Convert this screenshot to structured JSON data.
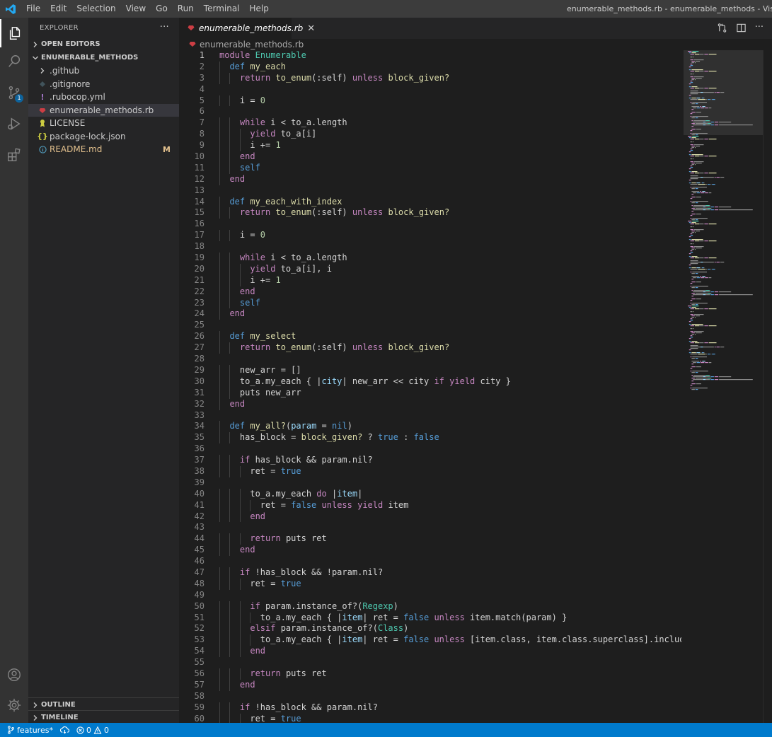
{
  "menu": [
    "File",
    "Edit",
    "Selection",
    "View",
    "Go",
    "Run",
    "Terminal",
    "Help"
  ],
  "window_title": "enumerable_methods.rb - enumerable_methods - Visual Studio Code",
  "sidebar": {
    "title": "EXPLORER",
    "more": "···",
    "open_editors": "OPEN EDITORS",
    "workspace": "ENUMERABLE_METHODS",
    "items": [
      {
        "label": ".github",
        "icon": "chevron-right-icon",
        "git": ""
      },
      {
        "label": ".gitignore",
        "icon": "gitignore-file-icon",
        "git": ""
      },
      {
        "label": ".rubocop.yml",
        "icon": "yaml-file-icon",
        "git": ""
      },
      {
        "label": "enumerable_methods.rb",
        "icon": "ruby-file-icon",
        "git": ""
      },
      {
        "label": "LICENSE",
        "icon": "license-file-icon",
        "git": ""
      },
      {
        "label": "package-lock.json",
        "icon": "json-file-icon",
        "git": ""
      },
      {
        "label": "README.md",
        "icon": "info-file-icon",
        "git": "M"
      }
    ],
    "outline": "OUTLINE",
    "timeline": "TIMELINE"
  },
  "editor": {
    "tab_label": "enumerable_methods.rb",
    "breadcrumb": "enumerable_methods.rb",
    "lines": [
      [
        [
          "kw",
          "module"
        ],
        [
          "t",
          " "
        ],
        [
          "cls",
          "Enumerable"
        ]
      ],
      [
        [
          "t",
          "  "
        ],
        [
          "def",
          "def"
        ],
        [
          "t",
          " "
        ],
        [
          "fn",
          "my_each"
        ]
      ],
      [
        [
          "t",
          "    "
        ],
        [
          "kw",
          "return"
        ],
        [
          "t",
          " "
        ],
        [
          "fn",
          "to_enum"
        ],
        [
          "t",
          "(:self) "
        ],
        [
          "kw",
          "unless"
        ],
        [
          "t",
          " "
        ],
        [
          "fn",
          "block_given?"
        ]
      ],
      [],
      [
        [
          "t",
          "    i = "
        ],
        [
          "num",
          "0"
        ]
      ],
      [],
      [
        [
          "t",
          "    "
        ],
        [
          "kw",
          "while"
        ],
        [
          "t",
          " i < to_a.length"
        ]
      ],
      [
        [
          "t",
          "      "
        ],
        [
          "kw",
          "yield"
        ],
        [
          "t",
          " to_a[i]"
        ]
      ],
      [
        [
          "t",
          "      i += "
        ],
        [
          "num",
          "1"
        ]
      ],
      [
        [
          "t",
          "    "
        ],
        [
          "kw",
          "end"
        ]
      ],
      [
        [
          "t",
          "    "
        ],
        [
          "con",
          "self"
        ]
      ],
      [
        [
          "t",
          "  "
        ],
        [
          "kw",
          "end"
        ]
      ],
      [],
      [
        [
          "t",
          "  "
        ],
        [
          "def",
          "def"
        ],
        [
          "t",
          " "
        ],
        [
          "fn",
          "my_each_with_index"
        ]
      ],
      [
        [
          "t",
          "    "
        ],
        [
          "kw",
          "return"
        ],
        [
          "t",
          " "
        ],
        [
          "fn",
          "to_enum"
        ],
        [
          "t",
          "(:self) "
        ],
        [
          "kw",
          "unless"
        ],
        [
          "t",
          " "
        ],
        [
          "fn",
          "block_given?"
        ]
      ],
      [],
      [
        [
          "t",
          "    i = "
        ],
        [
          "num",
          "0"
        ]
      ],
      [],
      [
        [
          "t",
          "    "
        ],
        [
          "kw",
          "while"
        ],
        [
          "t",
          " i < to_a.length"
        ]
      ],
      [
        [
          "t",
          "      "
        ],
        [
          "kw",
          "yield"
        ],
        [
          "t",
          " to_a[i], i"
        ]
      ],
      [
        [
          "t",
          "      i += "
        ],
        [
          "num",
          "1"
        ]
      ],
      [
        [
          "t",
          "    "
        ],
        [
          "kw",
          "end"
        ]
      ],
      [
        [
          "t",
          "    "
        ],
        [
          "con",
          "self"
        ]
      ],
      [
        [
          "t",
          "  "
        ],
        [
          "kw",
          "end"
        ]
      ],
      [],
      [
        [
          "t",
          "  "
        ],
        [
          "def",
          "def"
        ],
        [
          "t",
          " "
        ],
        [
          "fn",
          "my_select"
        ]
      ],
      [
        [
          "t",
          "    "
        ],
        [
          "kw",
          "return"
        ],
        [
          "t",
          " "
        ],
        [
          "fn",
          "to_enum"
        ],
        [
          "t",
          "(:self) "
        ],
        [
          "kw",
          "unless"
        ],
        [
          "t",
          " "
        ],
        [
          "fn",
          "block_given?"
        ]
      ],
      [],
      [
        [
          "t",
          "    new_arr = []"
        ]
      ],
      [
        [
          "t",
          "    to_a.my_each { |"
        ],
        [
          "var",
          "city"
        ],
        [
          "t",
          "| new_arr << city "
        ],
        [
          "kw",
          "if"
        ],
        [
          "t",
          " "
        ],
        [
          "kw",
          "yield"
        ],
        [
          "t",
          " city }"
        ]
      ],
      [
        [
          "t",
          "    puts new_arr"
        ]
      ],
      [
        [
          "t",
          "  "
        ],
        [
          "kw",
          "end"
        ]
      ],
      [],
      [
        [
          "t",
          "  "
        ],
        [
          "def",
          "def"
        ],
        [
          "t",
          " "
        ],
        [
          "fn",
          "my_all?"
        ],
        [
          "t",
          "("
        ],
        [
          "var",
          "param"
        ],
        [
          "t",
          " = "
        ],
        [
          "con",
          "nil"
        ],
        [
          "t",
          ")"
        ]
      ],
      [
        [
          "t",
          "    has_block = "
        ],
        [
          "fn",
          "block_given?"
        ],
        [
          "t",
          " ? "
        ],
        [
          "con",
          "true"
        ],
        [
          "t",
          " : "
        ],
        [
          "con",
          "false"
        ]
      ],
      [],
      [
        [
          "t",
          "    "
        ],
        [
          "kw",
          "if"
        ],
        [
          "t",
          " has_block && param.nil?"
        ]
      ],
      [
        [
          "t",
          "      ret = "
        ],
        [
          "con",
          "true"
        ]
      ],
      [],
      [
        [
          "t",
          "      to_a.my_each "
        ],
        [
          "kw",
          "do"
        ],
        [
          "t",
          " |"
        ],
        [
          "var",
          "item"
        ],
        [
          "t",
          "|"
        ]
      ],
      [
        [
          "t",
          "        ret = "
        ],
        [
          "con",
          "false"
        ],
        [
          "t",
          " "
        ],
        [
          "kw",
          "unless"
        ],
        [
          "t",
          " "
        ],
        [
          "kw",
          "yield"
        ],
        [
          "t",
          " item"
        ]
      ],
      [
        [
          "t",
          "      "
        ],
        [
          "kw",
          "end"
        ]
      ],
      [],
      [
        [
          "t",
          "      "
        ],
        [
          "kw",
          "return"
        ],
        [
          "t",
          " puts ret"
        ]
      ],
      [
        [
          "t",
          "    "
        ],
        [
          "kw",
          "end"
        ]
      ],
      [],
      [
        [
          "t",
          "    "
        ],
        [
          "kw",
          "if"
        ],
        [
          "t",
          " !has_block && !param.nil?"
        ]
      ],
      [
        [
          "t",
          "      ret = "
        ],
        [
          "con",
          "true"
        ]
      ],
      [],
      [
        [
          "t",
          "      "
        ],
        [
          "kw",
          "if"
        ],
        [
          "t",
          " param.instance_of?("
        ],
        [
          "cls",
          "Regexp"
        ],
        [
          "t",
          ")"
        ]
      ],
      [
        [
          "t",
          "        to_a.my_each { |"
        ],
        [
          "var",
          "item"
        ],
        [
          "t",
          "| ret = "
        ],
        [
          "con",
          "false"
        ],
        [
          "t",
          " "
        ],
        [
          "kw",
          "unless"
        ],
        [
          "t",
          " item.match(param) }"
        ]
      ],
      [
        [
          "t",
          "      "
        ],
        [
          "kw",
          "elsif"
        ],
        [
          "t",
          " param.instance_of?("
        ],
        [
          "cls",
          "Class"
        ],
        [
          "t",
          ")"
        ]
      ],
      [
        [
          "t",
          "        to_a.my_each { |"
        ],
        [
          "var",
          "item"
        ],
        [
          "t",
          "| ret = "
        ],
        [
          "con",
          "false"
        ],
        [
          "t",
          " "
        ],
        [
          "kw",
          "unless"
        ],
        [
          "t",
          " [item.class, item.class.superclass].include?(param) }"
        ]
      ],
      [
        [
          "t",
          "      "
        ],
        [
          "kw",
          "end"
        ]
      ],
      [],
      [
        [
          "t",
          "      "
        ],
        [
          "kw",
          "return"
        ],
        [
          "t",
          " puts ret"
        ]
      ],
      [
        [
          "t",
          "    "
        ],
        [
          "kw",
          "end"
        ]
      ],
      [],
      [
        [
          "t",
          "    "
        ],
        [
          "kw",
          "if"
        ],
        [
          "t",
          " !has_block && param.nil?"
        ]
      ],
      [
        [
          "t",
          "      ret = "
        ],
        [
          "con",
          "true"
        ]
      ]
    ]
  },
  "status": {
    "branch": "features*",
    "errors": "0",
    "warnings": "0"
  },
  "colors": {
    "statusbar": "#007acc",
    "activitybar": "#333333",
    "sidebar": "#252526",
    "editor": "#1e1e1e"
  }
}
